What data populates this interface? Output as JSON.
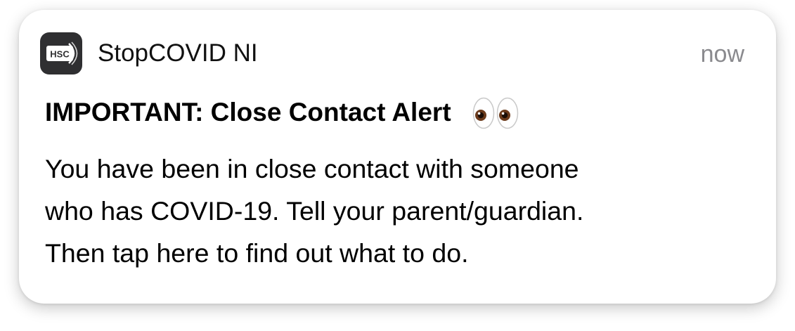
{
  "notification": {
    "app": {
      "icon": "hsc-logo-icon",
      "icon_text": "HSC",
      "name": "StopCOVID NI"
    },
    "timestamp": "now",
    "title": "IMPORTANT: Close Contact Alert",
    "title_emoji": "eyes-emoji",
    "message_lines": [
      "You have been in close contact with someone",
      "who has COVID-19. Tell your parent/guardian.",
      "Then tap here to find out what to do."
    ]
  },
  "colors": {
    "card_background": "#ffffff",
    "app_icon_background": "#2f2f31",
    "timestamp": "#8a8a8e",
    "text": "#000000"
  }
}
